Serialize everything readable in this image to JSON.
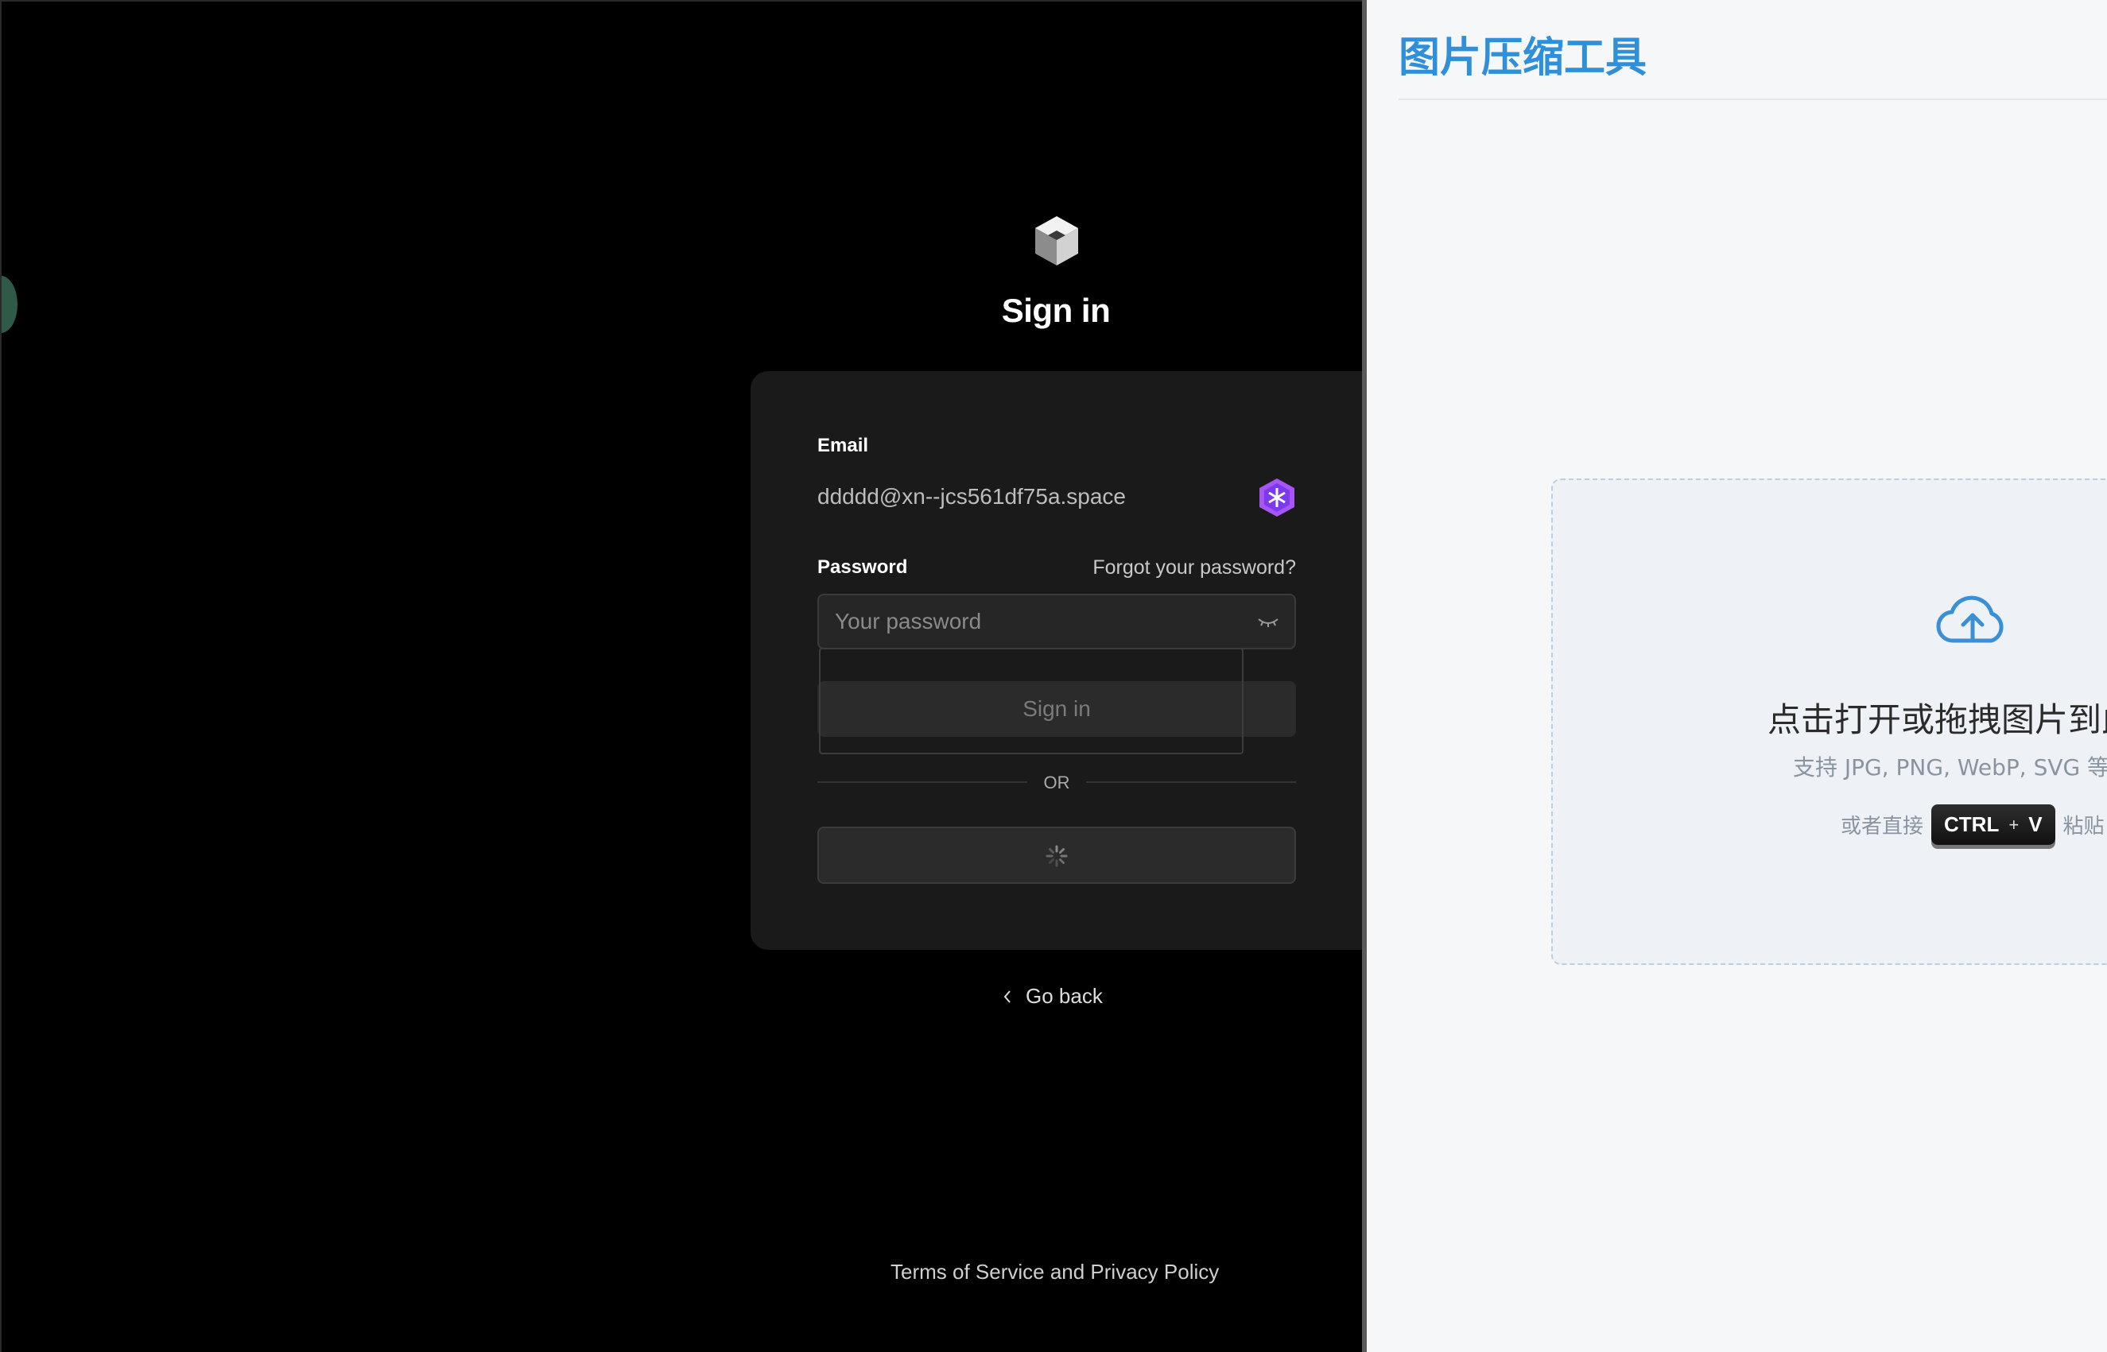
{
  "signin": {
    "title": "Sign in",
    "email_label": "Email",
    "email_value": "ddddd@xn--jcs561df75a.space",
    "password_label": "Password",
    "forgot_link": "Forgot your password?",
    "password_placeholder": "Your password",
    "submit_label": "Sign in",
    "divider_text": "OR",
    "go_back": "Go back",
    "terms": "Terms of Service and Privacy Policy"
  },
  "tool": {
    "title": "图片压缩工具",
    "drop_main": "点击打开或拖拽图片到此",
    "drop_sub": "支持 JPG, PNG, WebP, SVG 等格式",
    "paste_prefix": "或者直接",
    "kbd_ctrl": "CTRL",
    "kbd_plus": "+",
    "kbd_v": "V",
    "paste_suffix": "粘贴"
  },
  "colors": {
    "left_background": "#000000",
    "card_background": "#1a1a1a",
    "tool_title": "#2f8fd8",
    "extension_icon": "#a855f7",
    "right_background": "#f6f7f8"
  },
  "icons": {
    "logo": "cube-logo-icon",
    "extension": "password-manager-extension-icon",
    "password_toggle": "eye-closed-icon",
    "loading": "spinner-icon",
    "back": "chevron-left-icon",
    "upload": "cloud-upload-icon"
  }
}
